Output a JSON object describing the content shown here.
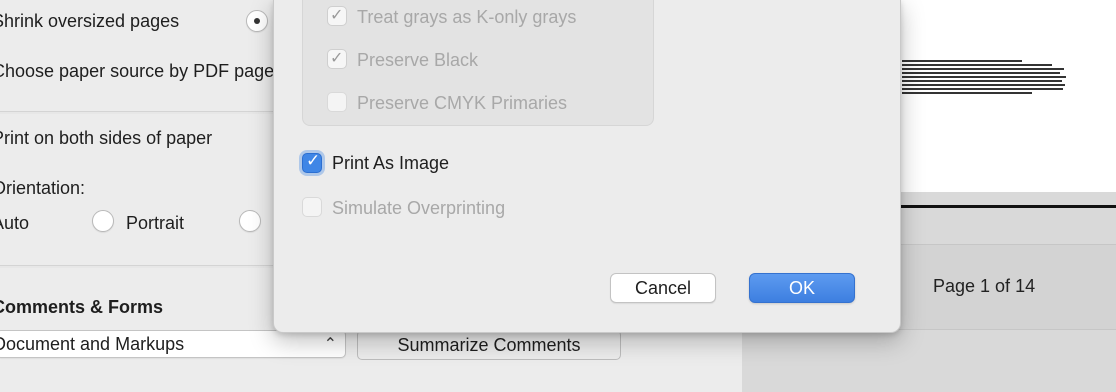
{
  "background_panel": {
    "shrink_label": "Shrink oversized pages",
    "paper_source_label": "Choose paper source by PDF page size",
    "duplex_label": "Print on both sides of paper",
    "orientation_label": "Orientation:",
    "orientation_auto": "Auto",
    "orientation_portrait": "Portrait",
    "comments_header": "Comments & Forms",
    "comments_select_value": "Document and Markups",
    "summarize_button": "Summarize Comments"
  },
  "dialog": {
    "treat_grays_label": "Treat grays as K-only grays",
    "preserve_black_label": "Preserve Black",
    "preserve_cmyk_label": "Preserve CMYK Primaries",
    "print_as_image_label": "Print As Image",
    "simulate_overprinting_label": "Simulate Overprinting",
    "cancel_label": "Cancel",
    "ok_label": "OK"
  },
  "preview": {
    "page_indicator": "Page 1 of 14"
  },
  "colors": {
    "accent": "#3f86e6",
    "ok_button": "#4a8be6"
  },
  "icons": {
    "select_stepper": "chevron-up-down-icon",
    "checkmark": "checkmark-icon"
  }
}
